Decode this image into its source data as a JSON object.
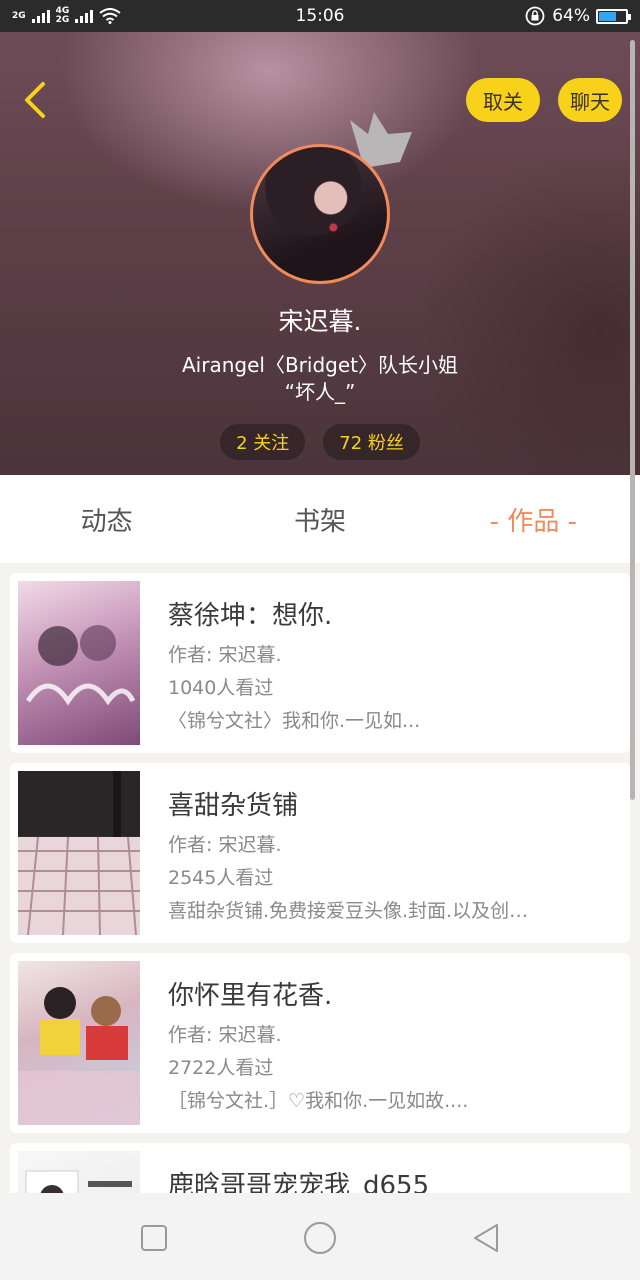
{
  "status_bar": {
    "net1": "2G",
    "net2": "4G",
    "net3": "2G",
    "time": "15:06",
    "battery": "64%",
    "battery_level": 0.64,
    "battery_color": "#3ba3ea"
  },
  "header": {
    "unfollow_label": "取关",
    "chat_label": "聊天",
    "username": "宋迟暮.",
    "bio_line1": "Airangel〈Bridget〉队长小姐",
    "bio_line2": "“坏人_”",
    "following": "2 关注",
    "followers": "72 粉丝",
    "accent_color": "#f8d21a"
  },
  "tabs": [
    {
      "label": "动态"
    },
    {
      "label": "书架"
    },
    {
      "label": "- 作品 -"
    }
  ],
  "works": [
    {
      "title": "蔡徐坤：想你.",
      "author": "作者: 宋迟暮.",
      "views": "1040人看过",
      "desc": "〈锦兮文社〉我和你.一见如..."
    },
    {
      "title": "喜甜杂货铺",
      "author": "作者: 宋迟暮.",
      "views": "2545人看过",
      "desc": "喜甜杂货铺.免费接爱豆头像.封面.以及创…"
    },
    {
      "title": "你怀里有花香.",
      "author": "作者: 宋迟暮.",
      "views": "2722人看过",
      "desc": "［锦兮文社.］♡我和你.一见如故...."
    },
    {
      "title": "鹿晗哥哥宠宠我_d655",
      "author": "",
      "views": "",
      "desc": ""
    }
  ],
  "icons": {
    "back": "chevron-left-icon",
    "crown": "crown-icon",
    "nav_recent": "square-icon",
    "nav_home": "circle-icon",
    "nav_back": "triangle-back-icon"
  },
  "colors": {
    "active_tab": "#f08b5b",
    "avatar_ring": "#f08b5b"
  }
}
